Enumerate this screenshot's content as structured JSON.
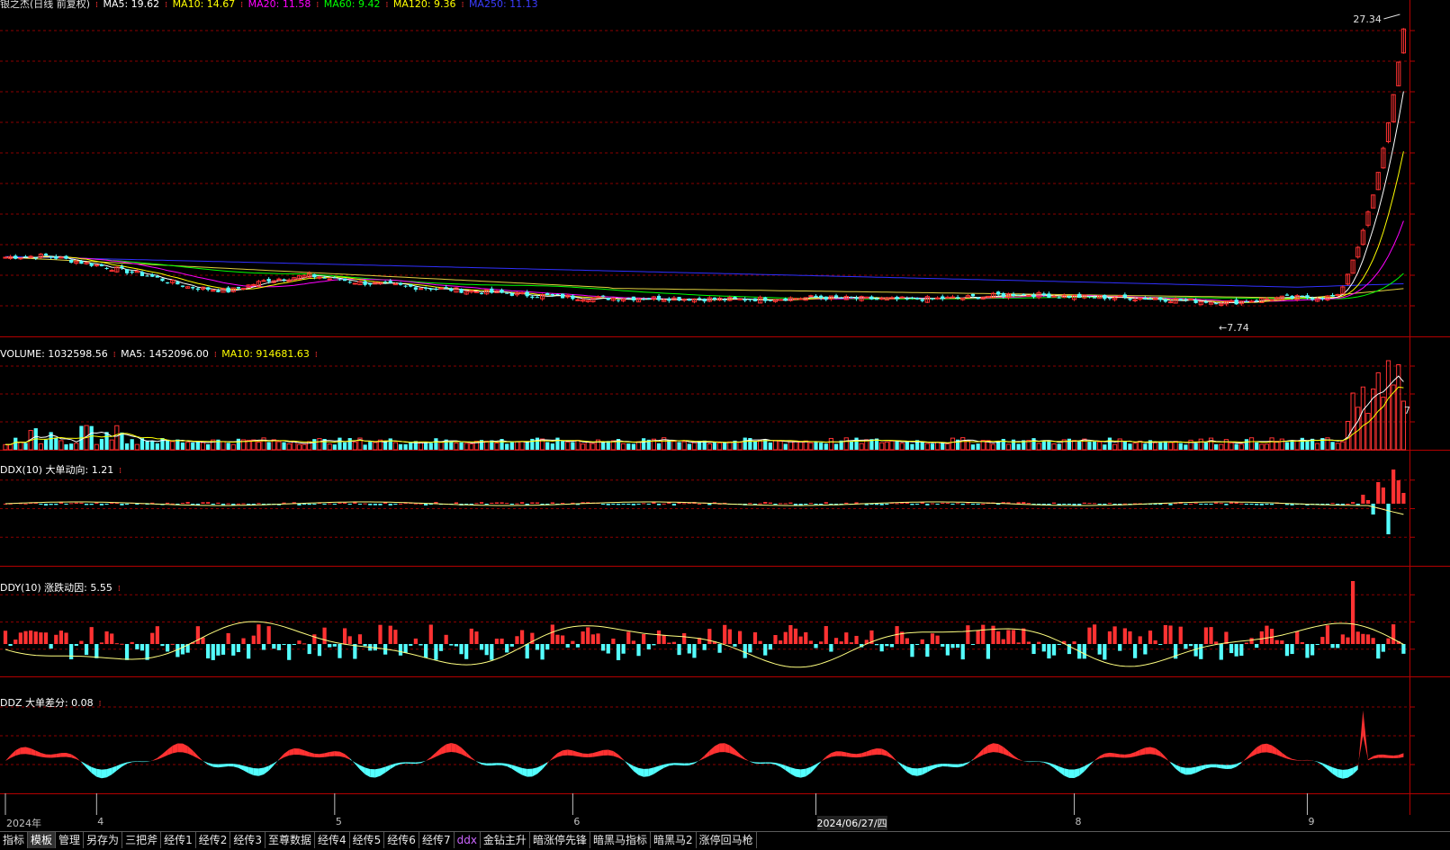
{
  "legends": {
    "main": {
      "title": "银之杰(日线 前复权)",
      "items": [
        {
          "label": "MA5: 19.62",
          "color": "#ffffff"
        },
        {
          "label": "MA10: 14.67",
          "color": "#ffff00"
        },
        {
          "label": "MA20: 11.58",
          "color": "#ff00ff"
        },
        {
          "label": "MA60: 9.42",
          "color": "#00ff00"
        },
        {
          "label": "MA120: 9.36",
          "color": "#ffff00"
        },
        {
          "label": "MA250: 11.13",
          "color": "#3c3cff"
        }
      ]
    },
    "volume": {
      "items": [
        {
          "label": "VOLUME: 1032598.56",
          "color": "#ffffff"
        },
        {
          "label": "MA5: 1452096.00",
          "color": "#ffffff"
        },
        {
          "label": "MA10: 914681.63",
          "color": "#ffff00"
        }
      ]
    },
    "ddx": {
      "items": [
        {
          "label": "DDX(10) 大单动向: 1.21",
          "color": "#ffffff"
        }
      ]
    },
    "ddy": {
      "items": [
        {
          "label": "DDY(10) 涨跌动因: 5.55",
          "color": "#ffffff"
        }
      ]
    },
    "ddz": {
      "items": [
        {
          "label": "DDZ 大单差分: 0.08",
          "color": "#ffffff"
        }
      ]
    }
  },
  "annotations": {
    "high_price": "27.34",
    "low_price": "7.74",
    "volume_axis_digit": "7"
  },
  "date_axis": {
    "labels": [
      "2024年",
      "4",
      "5",
      "6",
      "2024/06/27/四",
      "8",
      "9"
    ],
    "label_days": [
      0,
      18,
      65,
      112,
      160,
      211,
      257
    ]
  },
  "tabs": [
    {
      "label": "指标",
      "active": false
    },
    {
      "label": "模板",
      "active": true
    },
    {
      "label": "管理",
      "active": false
    },
    {
      "label": "另存为",
      "active": false
    },
    {
      "label": "三把斧",
      "active": false
    },
    {
      "label": "经传1",
      "active": false
    },
    {
      "label": "经传2",
      "active": false
    },
    {
      "label": "经传3",
      "active": false
    },
    {
      "label": "至尊数据",
      "active": false
    },
    {
      "label": "经传4",
      "active": false
    },
    {
      "label": "经传5",
      "active": false
    },
    {
      "label": "经传6",
      "active": false
    },
    {
      "label": "经传7",
      "active": false
    },
    {
      "label": "ddx",
      "active": false
    },
    {
      "label": "金钻主升",
      "active": false
    },
    {
      "label": "暗涨停先锋",
      "active": false
    },
    {
      "label": "暗黑马指标",
      "active": false
    },
    {
      "label": "暗黑马2",
      "active": false
    },
    {
      "label": "涨停回马枪",
      "active": false
    }
  ],
  "colors": {
    "up": "#ff3232",
    "down": "#54ffff",
    "grid": "#8b0000",
    "frame": "#b40000",
    "ma5": "#ffffff",
    "ma10": "#ffff00",
    "ma20": "#ff00ff",
    "ma60": "#00ff00",
    "ma120": "#e0d040",
    "ma250": "#3030ff"
  },
  "chart_data": {
    "type": "candlestick",
    "price_range": [
      7.0,
      28.5
    ],
    "high": 27.34,
    "low": 7.74,
    "days": 270,
    "anchors": [
      [
        0,
        11.2
      ],
      [
        8,
        11.3
      ],
      [
        14,
        10.9
      ],
      [
        20,
        10.5
      ],
      [
        28,
        9.9
      ],
      [
        36,
        9.1
      ],
      [
        44,
        8.8
      ],
      [
        52,
        9.6
      ],
      [
        60,
        9.9
      ],
      [
        70,
        9.4
      ],
      [
        80,
        9.1
      ],
      [
        92,
        8.8
      ],
      [
        104,
        8.5
      ],
      [
        116,
        8.3
      ],
      [
        130,
        8.3
      ],
      [
        145,
        8.2
      ],
      [
        160,
        8.35
      ],
      [
        175,
        8.2
      ],
      [
        188,
        8.3
      ],
      [
        200,
        8.6
      ],
      [
        212,
        8.4
      ],
      [
        225,
        8.3
      ],
      [
        235,
        8.1
      ],
      [
        242,
        8.0
      ],
      [
        250,
        8.3
      ],
      [
        258,
        8.35
      ],
      [
        263,
        8.4
      ]
    ],
    "rally_closes": [
      9.1,
      10.0,
      11.0,
      11.9,
      13.1,
      14.4,
      15.6,
      17.2,
      18.9,
      20.7,
      22.7,
      25.0,
      27.34
    ]
  }
}
